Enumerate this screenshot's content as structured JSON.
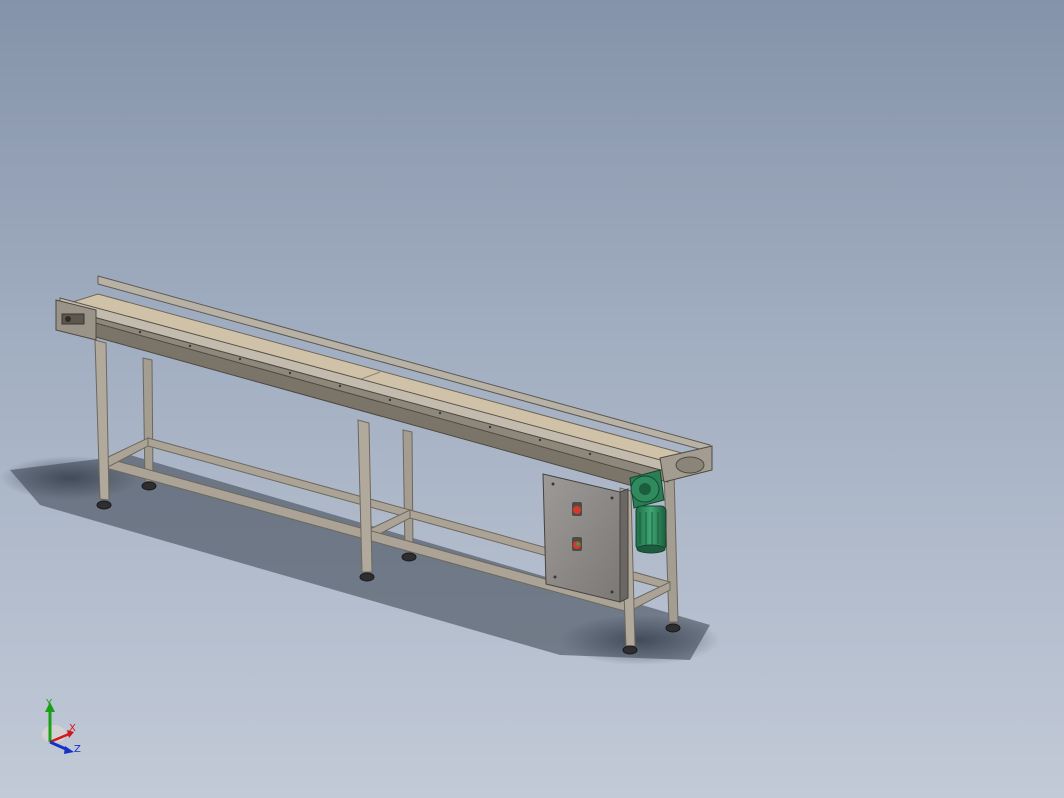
{
  "viewport": {
    "background_top": "#8593aa",
    "background_bottom": "#c2cad7"
  },
  "model": {
    "subject": "belt-conveyor-assembly",
    "frame_color": "#9c9488",
    "belt_color": "#cfc2a8",
    "panel_color": "#8e8b89",
    "motor_color": "#2f8a5e",
    "start_button_color": "#d23a2a",
    "stop_button_color": "#3aa04a"
  },
  "triad": {
    "x_label": "X",
    "y_label": "Y",
    "z_label": "Z",
    "x_color": "#d01818",
    "y_color": "#18a018",
    "z_color": "#1830c8"
  }
}
